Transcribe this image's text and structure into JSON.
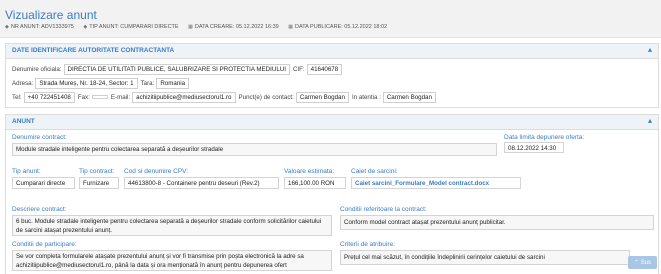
{
  "header": {
    "title": "Vizualizare anunt",
    "nr_anunt": "NR ANUNT: ADV1333975",
    "tip_anunt": "TIP ANUNT: CUMPARARI DIRECTE",
    "data_creare": "DATA CREARE: 05.12.2022 16:39",
    "data_publicare": "DATA PUBLICARE: 05.12.2022 18:02"
  },
  "authority": {
    "section_title": "DATE IDENTIFICARE AUTORITATE CONTRACTANTA",
    "denumire_label": "Denumire oficiala:",
    "denumire": "DIRECTIA DE UTILITATI PUBLICE, SALUBRIZARE SI PROTECTIA MEDIULUI",
    "cif_label": "CIF:",
    "cif": "41640678",
    "adresa_label": "Adresa:",
    "adresa": "Strada Mureș, Nr. 18-24, Sector: 1",
    "tara_label": "Tara:",
    "tara": "Romania",
    "tel_label": "Tel:",
    "tel": "+40 722451408",
    "fax_label": "Fax:",
    "fax": "",
    "email_label": "E-mail:",
    "email": "achizitiipublice@mediusectorul1.ro",
    "contact_label": "Punct(e) de contact:",
    "contact": "Carmen Bogdan",
    "atentia_label": "In atentia :",
    "atentia": "Carmen Bogdan"
  },
  "anunt": {
    "section_title": "ANUNT",
    "denumire_contract_label": "Denumire contract:",
    "denumire_contract": "Module stradale inteligente pentru colectarea separată a deșeurilor stradale",
    "data_limita_label": "Data limita depunere oferta:",
    "data_limita": "08.12.2022 14:30",
    "tip_anunt_label": "Tip anunt:",
    "tip_anunt": "Cumparari directe",
    "tip_contract_label": "Tip contract:",
    "tip_contract": "Furnizare",
    "cpv_label": "Cod si denumire CPV:",
    "cpv": "44613800-8 - Containere pentru deseuri (Rev.2)",
    "valoare_label": "Valoare estimata:",
    "valoare": "166,100.00",
    "moneda": "RON",
    "caiet_label": "Caiet de sarcini:",
    "caiet": "Caiet sarcini_Formulare_Model contract.docx",
    "descriere_label": "Descriere contract:",
    "descriere": "6 buc. Module stradale inteligente pentru colectarea separată a deșeurilor stradale conform solicitărilor caietului de sarcini atașat prezentului anunț.",
    "conditii_ref_label": "Conditii referitoare la contract:",
    "conditii_ref": "Conform model contract atașat prezentului anunț publicitar.",
    "conditii_part_label": "Conditii de participare:",
    "conditii_part": "Se vor completa formularele atașate prezentului anunț și vor fi transmise prin poșta electronică la adre sa achizitiipublice@mediusectorul1.ro, până la data și ora menționată în anunț pentru depunerea ofert",
    "criterii_label": "Criterii de atribuire:",
    "criterii": "Prețul cel mai scăzut, în condițiile îndeplinirii cerințelor caietului de sarcini"
  },
  "scroll_up": "Sus",
  "icons": {
    "collapse": "chevron-up-icon",
    "tag": "tag-icon",
    "calendar": "calendar-icon"
  },
  "colors": {
    "accent": "#3b7cc4",
    "panel_header": "#eef3f8"
  }
}
